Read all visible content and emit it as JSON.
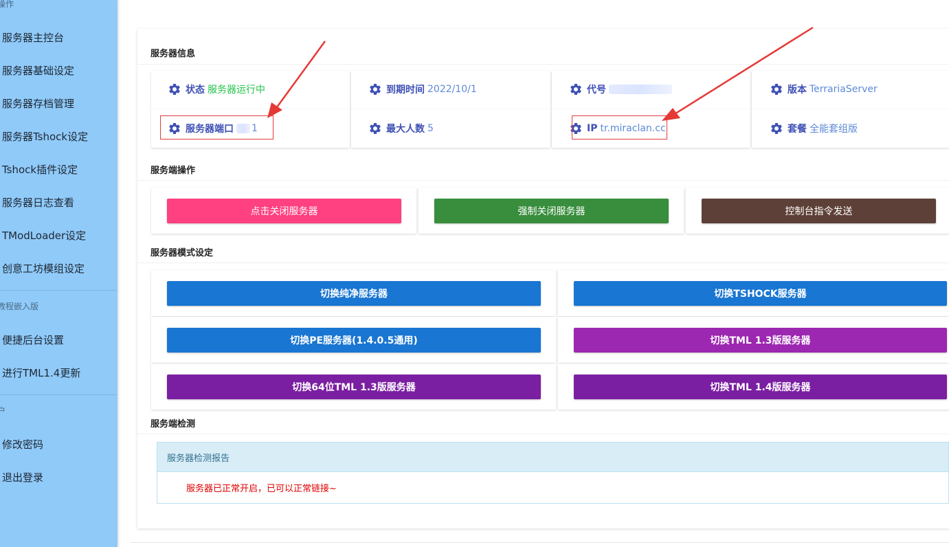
{
  "sidebar": {
    "sections": [
      {
        "title": "操作",
        "items": [
          "服务器主控台",
          "服务器基础设定",
          "服务器存档管理",
          "服务器Tshock设定",
          "Tshock插件设定",
          "服务器日志查看",
          "TModLoader设定",
          "创意工坊模组设定"
        ]
      },
      {
        "title": "教程嵌入版",
        "items": [
          "便捷后台设置",
          "进行TML1.4更新"
        ]
      },
      {
        "title": "户",
        "items": [
          "修改密码",
          "退出登录"
        ]
      }
    ]
  },
  "info_section": {
    "title": "服务器信息",
    "status": {
      "label": "状态",
      "value": "服务器运行中"
    },
    "expire": {
      "label": "到期时间",
      "value": "2022/10/1"
    },
    "code": {
      "label": "代号",
      "value": ""
    },
    "version": {
      "label": "版本",
      "value": "TerrariaServer"
    },
    "port": {
      "label": "服务器端口",
      "value": "1"
    },
    "max_players": {
      "label": "最大人数",
      "value": "5"
    },
    "ip": {
      "label": "IP",
      "value": "tr.miraclan.cc"
    },
    "plan": {
      "label": "套餐",
      "value": "全能套组版"
    }
  },
  "ops_section": {
    "title": "服务端操作",
    "close_button": "点击关闭服务器",
    "force_close_button": "强制关闭服务器",
    "console_button": "控制台指令发送"
  },
  "mode_section": {
    "title": "服务器模式设定",
    "pure_button": "切换纯净服务器",
    "tshock_button": "切换TSHOCK服务器",
    "pe_button": "切换PE服务器(1.4.0.5通用)",
    "tml13_button": "切换TML 1.3版服务器",
    "tml13_64_button": "切换64位TML 1.3版服务器",
    "tml14_button": "切换TML 1.4版服务器"
  },
  "check_section": {
    "title": "服务端检测",
    "report_title": "服务器检测报告",
    "report_message": "服务器已正常开启，已可以正常链接~"
  },
  "colors": {
    "sidebar": "#90caf9",
    "pink": "#ff4081",
    "green": "#388e3c",
    "brown": "#5d4037",
    "blue": "#1976d2",
    "purple": "#9c27b0",
    "deep_purple": "#7b1fa2",
    "icon": "#3f51b5",
    "annotation": "#e03a3a"
  }
}
